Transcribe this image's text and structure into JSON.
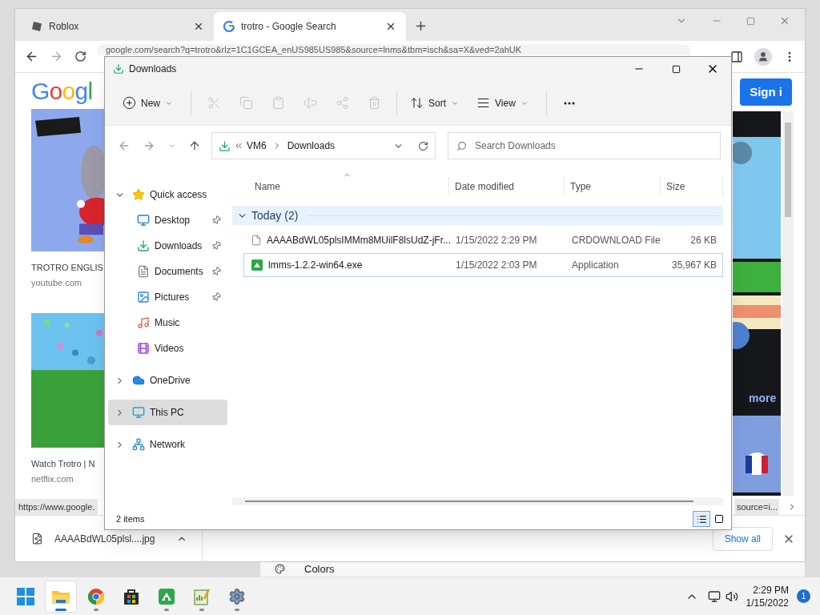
{
  "browser": {
    "tabs": [
      {
        "title": "Roblox",
        "kind": "roblox",
        "selected": false
      },
      {
        "title": "trotro - Google Search",
        "kind": "google",
        "selected": true
      }
    ],
    "address": "google.com/search?q=trotro&rlz=1C1GCEA_enUS985US985&source=lnms&tbm=isch&sa=X&ved=2ahUK",
    "page": {
      "logo": "Googl",
      "sign_in": "Sign i",
      "results": [
        {
          "title": "TROTRO ENGLIS",
          "source": "youtube.com"
        },
        {
          "title": "Watch Trotro | N",
          "source": "netflix.com"
        }
      ],
      "more_link": "more"
    },
    "status_url": "https://www.google.",
    "status_url_tail": "source=i...",
    "download_shelf": {
      "file": "AAAABdWL05plsl....jpg",
      "show_all": "Show all"
    }
  },
  "settings_behind": {
    "item": "Colors"
  },
  "explorer": {
    "title": "Downloads",
    "toolbar": [
      {
        "kind": "new",
        "label": "New",
        "disabled": false
      },
      {
        "kind": "cut",
        "disabled": true
      },
      {
        "kind": "copy",
        "disabled": true
      },
      {
        "kind": "paste",
        "disabled": true
      },
      {
        "kind": "rename",
        "disabled": true
      },
      {
        "kind": "share",
        "disabled": true
      },
      {
        "kind": "delete",
        "disabled": true
      },
      {
        "kind": "sort",
        "label": "Sort",
        "disabled": false
      },
      {
        "kind": "view",
        "label": "View",
        "disabled": false
      },
      {
        "kind": "more",
        "disabled": false
      }
    ],
    "breadcrumb": [
      "VM6",
      "Downloads"
    ],
    "search": {
      "placeholder": "Search Downloads"
    },
    "nav": [
      {
        "label": "Quick access",
        "kind": "star",
        "expanded": true,
        "selected": false,
        "children": [
          {
            "label": "Desktop",
            "kind": "desktop",
            "pinned": true,
            "selected": false
          },
          {
            "label": "Downloads",
            "kind": "downloads",
            "pinned": true,
            "selected": false
          },
          {
            "label": "Documents",
            "kind": "documents",
            "pinned": true,
            "selected": false
          },
          {
            "label": "Pictures",
            "kind": "pictures",
            "pinned": true,
            "selected": false
          },
          {
            "label": "Music",
            "kind": "music",
            "pinned": false,
            "selected": false
          },
          {
            "label": "Videos",
            "kind": "videos",
            "pinned": false,
            "selected": false
          }
        ]
      },
      {
        "label": "OneDrive",
        "kind": "cloud",
        "expanded": false,
        "selected": false
      },
      {
        "label": "This PC",
        "kind": "pc",
        "expanded": false,
        "selected": true
      },
      {
        "label": "Network",
        "kind": "network",
        "expanded": false,
        "selected": false
      }
    ],
    "columns": [
      "Name",
      "Date modified",
      "Type",
      "Size"
    ],
    "group": {
      "label": "Today (2)",
      "expanded": true
    },
    "files": [
      {
        "name": "AAAABdWL05plsIMMm8MUilF8lsUdZ-jFr...",
        "date": "1/15/2022 2:29 PM",
        "type": "CRDOWNLOAD File",
        "size": "26 KB",
        "kind": "file",
        "selected": false
      },
      {
        "name": "lmms-1.2.2-win64.exe",
        "date": "1/15/2022 2:03 PM",
        "type": "Application",
        "size": "35,967 KB",
        "kind": "app",
        "selected": true
      }
    ],
    "status": "2 items",
    "views": [
      {
        "kind": "details",
        "selected": true
      },
      {
        "kind": "tiles",
        "selected": false
      }
    ]
  },
  "taskbar": {
    "apps": [
      {
        "kind": "start",
        "running": false,
        "selected": false
      },
      {
        "kind": "explorer",
        "running": true,
        "selected": true
      },
      {
        "kind": "chrome",
        "running": true,
        "selected": false
      },
      {
        "kind": "store",
        "running": false,
        "selected": false
      },
      {
        "kind": "lmms",
        "running": true,
        "selected": false
      },
      {
        "kind": "notepad",
        "running": true,
        "selected": false
      },
      {
        "kind": "settings",
        "running": true,
        "selected": false
      }
    ],
    "time": "2:29 PM",
    "date": "1/15/2022",
    "notifications": "1"
  }
}
